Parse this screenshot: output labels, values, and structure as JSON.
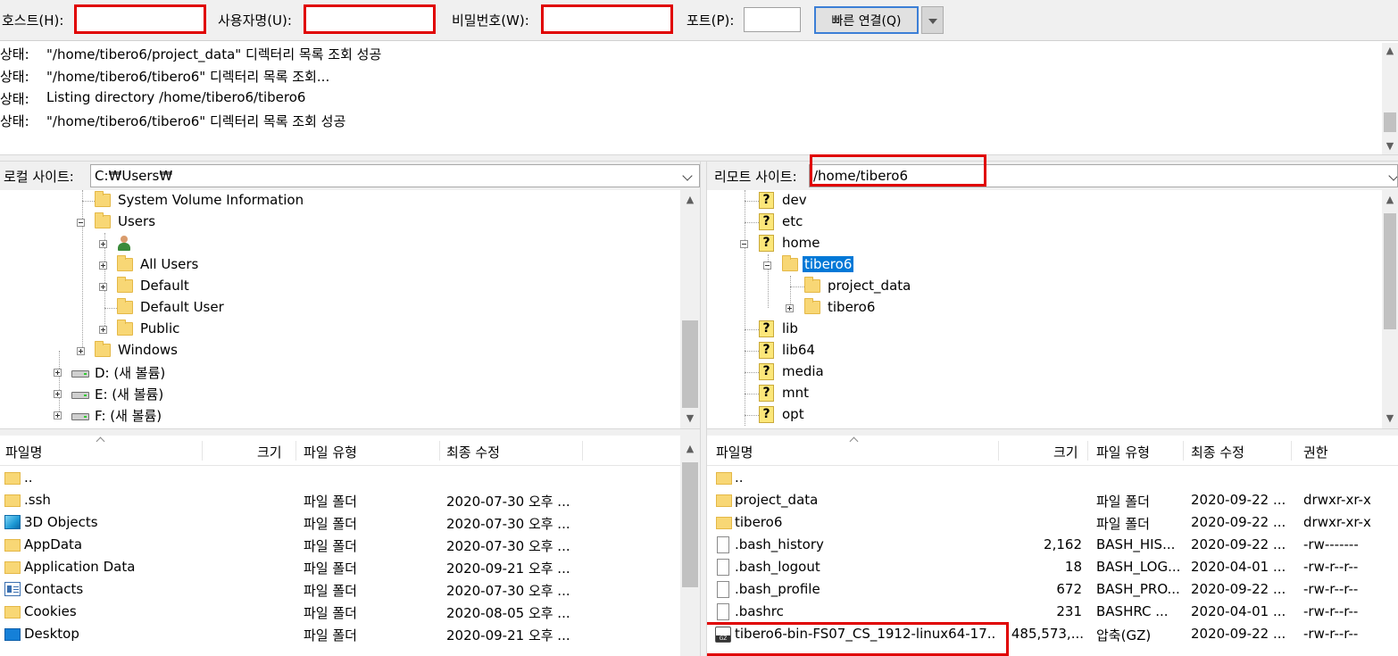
{
  "quickconnect": {
    "host_label": "호스트(H):",
    "user_label": "사용자명(U):",
    "pass_label": "비밀번호(W):",
    "port_label": "포트(P):",
    "connect_label": "빠른 연결(Q)"
  },
  "log": {
    "lines": [
      {
        "label": "상태:",
        "message": "\"/home/tibero6/project_data\" 디렉터리 목록 조회 성공"
      },
      {
        "label": "상태:",
        "message": "\"/home/tibero6/tibero6\" 디렉터리 목록 조회..."
      },
      {
        "label": "상태:",
        "message": "Listing directory /home/tibero6/tibero6"
      },
      {
        "label": "상태:",
        "message": "\"/home/tibero6/tibero6\" 디렉터리 목록 조회 성공"
      }
    ]
  },
  "local": {
    "site_label": "로컬 사이트:",
    "path": "C:₩Users₩",
    "tree": [
      {
        "label": "System Volume Information",
        "icon": "folder-icon"
      },
      {
        "label": "Users",
        "icon": "folder-icon"
      },
      {
        "label": "",
        "icon": "user-icon"
      },
      {
        "label": "All Users",
        "icon": "folder-icon"
      },
      {
        "label": "Default",
        "icon": "folder-icon"
      },
      {
        "label": "Default User",
        "icon": "folder-icon"
      },
      {
        "label": "Public",
        "icon": "folder-icon"
      },
      {
        "label": "Windows",
        "icon": "folder-icon"
      },
      {
        "label": "D: (새 볼륨)",
        "icon": "drive-icon"
      },
      {
        "label": "E: (새 볼륨)",
        "icon": "drive-icon"
      },
      {
        "label": "F: (새 볼륨)",
        "icon": "drive-icon"
      }
    ],
    "columns": [
      "파일명",
      "크기",
      "파일 유형",
      "최종 수정"
    ],
    "files": [
      {
        "name": "..",
        "size": "",
        "type": "",
        "modified": "",
        "icon": "folder-icon"
      },
      {
        "name": ".ssh",
        "size": "",
        "type": "파일 폴더",
        "modified": "2020-07-30 오후 ...",
        "icon": "folder-icon"
      },
      {
        "name": "3D Objects",
        "size": "",
        "type": "파일 폴더",
        "modified": "2020-07-30 오후 ...",
        "icon": "3d-objects-icon"
      },
      {
        "name": "AppData",
        "size": "",
        "type": "파일 폴더",
        "modified": "2020-07-30 오후 ...",
        "icon": "folder-icon"
      },
      {
        "name": "Application Data",
        "size": "",
        "type": "파일 폴더",
        "modified": "2020-09-21 오후 ...",
        "icon": "folder-icon"
      },
      {
        "name": "Contacts",
        "size": "",
        "type": "파일 폴더",
        "modified": "2020-07-30 오후 ...",
        "icon": "contacts-icon"
      },
      {
        "name": "Cookies",
        "size": "",
        "type": "파일 폴더",
        "modified": "2020-08-05 오후 ...",
        "icon": "folder-icon"
      },
      {
        "name": "Desktop",
        "size": "",
        "type": "파일 폴더",
        "modified": "2020-09-21 오후 ...",
        "icon": "desktop-icon"
      }
    ]
  },
  "remote": {
    "site_label": "리모트 사이트:",
    "path": "/home/tibero6",
    "tree": [
      {
        "label": "dev",
        "icon": "unknown-folder-icon"
      },
      {
        "label": "etc",
        "icon": "unknown-folder-icon"
      },
      {
        "label": "home",
        "icon": "unknown-folder-icon"
      },
      {
        "label": "tibero6",
        "icon": "folder-icon"
      },
      {
        "label": "project_data",
        "icon": "folder-icon"
      },
      {
        "label": "tibero6",
        "icon": "folder-icon"
      },
      {
        "label": "lib",
        "icon": "unknown-folder-icon"
      },
      {
        "label": "lib64",
        "icon": "unknown-folder-icon"
      },
      {
        "label": "media",
        "icon": "unknown-folder-icon"
      },
      {
        "label": "mnt",
        "icon": "unknown-folder-icon"
      },
      {
        "label": "opt",
        "icon": "unknown-folder-icon"
      }
    ],
    "columns": [
      "파일명",
      "크기",
      "파일 유형",
      "최종 수정",
      "권한"
    ],
    "files": [
      {
        "name": "..",
        "size": "",
        "type": "",
        "modified": "",
        "perms": "",
        "icon": "folder-icon"
      },
      {
        "name": "project_data",
        "size": "",
        "type": "파일 폴더",
        "modified": "2020-09-22 ...",
        "perms": "drwxr-xr-x",
        "icon": "folder-icon"
      },
      {
        "name": "tibero6",
        "size": "",
        "type": "파일 폴더",
        "modified": "2020-09-22 ...",
        "perms": "drwxr-xr-x",
        "icon": "folder-icon"
      },
      {
        "name": ".bash_history",
        "size": "2,162",
        "type": "BASH_HIS...",
        "modified": "2020-09-22 ...",
        "perms": "-rw-------",
        "icon": "file-icon"
      },
      {
        "name": ".bash_logout",
        "size": "18",
        "type": "BASH_LOG...",
        "modified": "2020-04-01 ...",
        "perms": "-rw-r--r--",
        "icon": "file-icon"
      },
      {
        "name": ".bash_profile",
        "size": "672",
        "type": "BASH_PRO...",
        "modified": "2020-09-22 ...",
        "perms": "-rw-r--r--",
        "icon": "file-icon"
      },
      {
        "name": ".bashrc",
        "size": "231",
        "type": "BASHRC ...",
        "modified": "2020-04-01 ...",
        "perms": "-rw-r--r--",
        "icon": "file-icon"
      },
      {
        "name": "tibero6-bin-FS07_CS_1912-linux64-17...",
        "size": "485,573,...",
        "type": "압축(GZ)",
        "modified": "2020-09-22 ...",
        "perms": "-rw-r--r--",
        "icon": "gz-archive-icon"
      }
    ]
  },
  "colors": {
    "highlight_box": "#e00000",
    "selection": "#0078d7",
    "connect_border": "#3c7fd6"
  }
}
